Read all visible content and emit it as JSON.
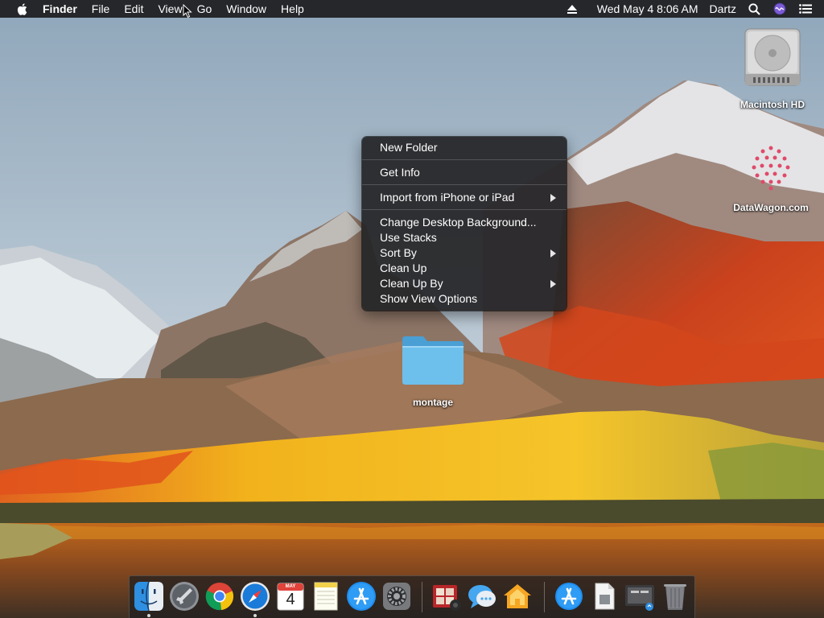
{
  "menubar": {
    "app_name": "Finder",
    "menus": [
      "File",
      "Edit",
      "View",
      "Go",
      "Window",
      "Help"
    ],
    "datetime": "Wed May 4  8:06 AM",
    "user": "Dartz"
  },
  "desktop": {
    "drive_label": "Macintosh HD",
    "watermark_label": "DataWagon.com",
    "folder_label": "montage"
  },
  "context_menu": {
    "new_folder": "New Folder",
    "get_info": "Get Info",
    "import": "Import from iPhone or iPad",
    "change_bg": "Change Desktop Background...",
    "use_stacks": "Use Stacks",
    "sort_by": "Sort By",
    "clean_up": "Clean Up",
    "clean_up_by": "Clean Up By",
    "show_view_options": "Show View Options"
  },
  "dock": {
    "items": [
      "finder-icon",
      "launchpad-icon",
      "chrome-icon",
      "safari-icon",
      "calendar-icon",
      "notes-icon",
      "app-store-icon",
      "system-preferences-icon",
      "photo-booth-icon",
      "messages-icon",
      "home-icon",
      "app-store-download-icon",
      "preview-document-icon",
      "screenshot-icon",
      "trash-icon"
    ],
    "calendar_month": "MAY",
    "calendar_day": "4"
  },
  "colors": {
    "menubar_bg": "#1c1c1e",
    "menu_bg": "#262628",
    "folder_blue": "#5fb4e6",
    "safari_blue": "#1a7bd9"
  }
}
